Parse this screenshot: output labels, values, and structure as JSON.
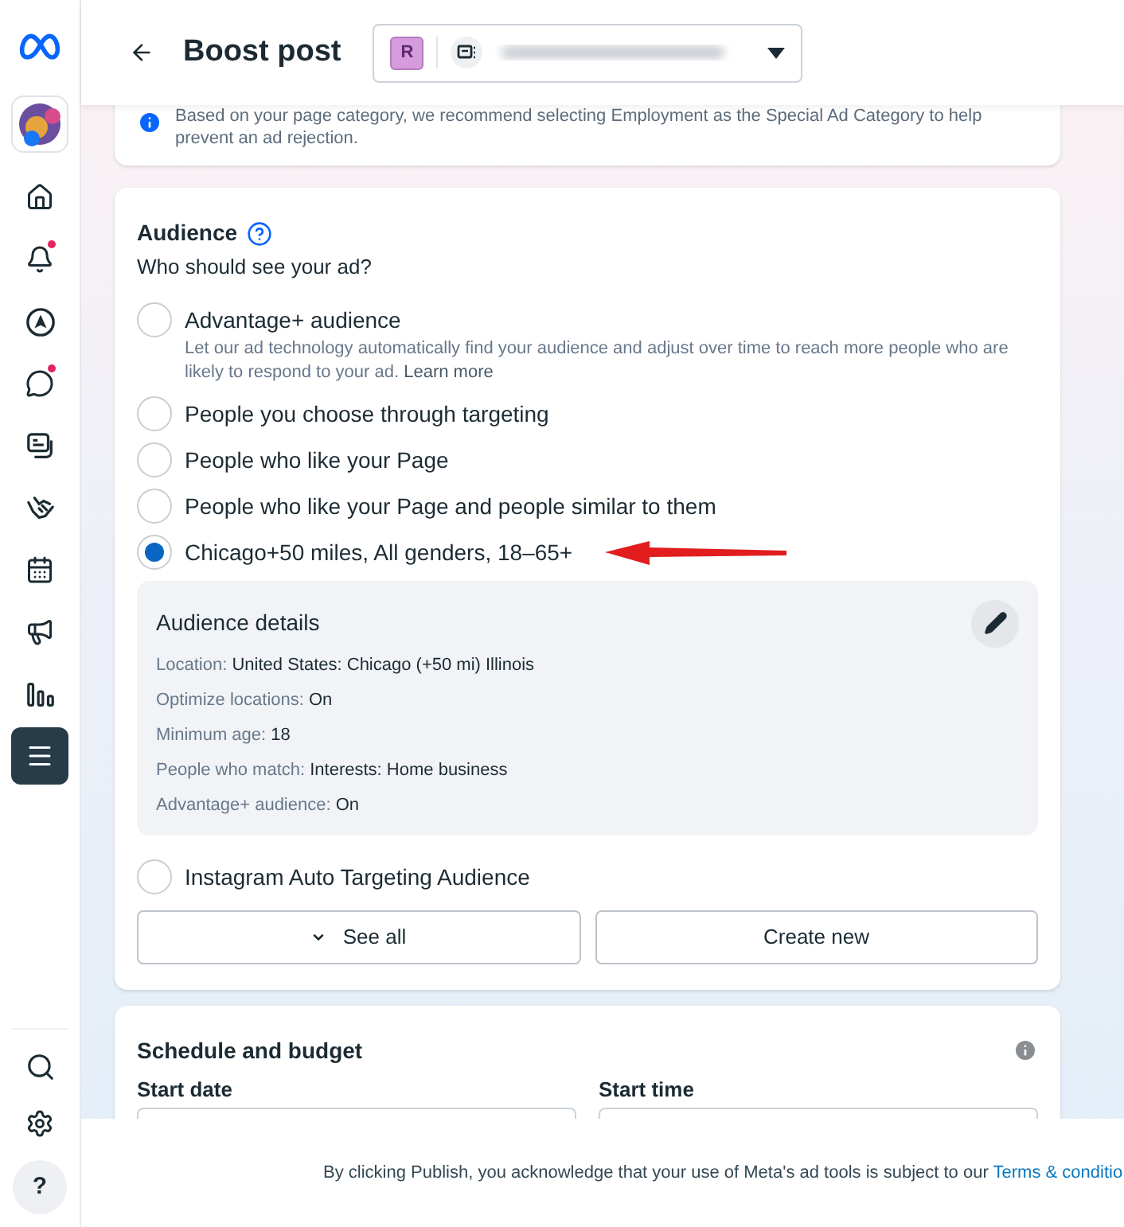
{
  "sidebar": {
    "items": [
      {
        "kind": "home",
        "selected": false,
        "badge": false
      },
      {
        "kind": "bell",
        "selected": false,
        "badge": true
      },
      {
        "kind": "compass",
        "selected": false,
        "badge": false
      },
      {
        "kind": "chat",
        "selected": false,
        "badge": true
      },
      {
        "kind": "cards",
        "selected": false,
        "badge": false
      },
      {
        "kind": "handshake",
        "selected": false,
        "badge": false
      },
      {
        "kind": "calendar",
        "selected": false,
        "badge": false
      },
      {
        "kind": "megaphone",
        "selected": false,
        "badge": false
      },
      {
        "kind": "chart",
        "selected": false,
        "badge": false
      },
      {
        "kind": "menu",
        "selected": true,
        "badge": false
      }
    ],
    "bottom": [
      {
        "kind": "search"
      },
      {
        "kind": "settings"
      },
      {
        "kind": "help",
        "label": "?"
      }
    ]
  },
  "header": {
    "title": "Boost post",
    "account": {
      "initial": "R"
    }
  },
  "notice": {
    "text": "Based on your page category, we recommend selecting Employment as the Special Ad Category to help prevent an ad rejection."
  },
  "audience": {
    "title": "Audience",
    "subtitle": "Who should see your ad?",
    "options": [
      {
        "label": "Advantage+ audience",
        "selected": false,
        "description": "Let our ad technology automatically find your audience and adjust over time to reach more people who are likely to respond to your ad.",
        "link": "Learn more"
      },
      {
        "label": "People you choose through targeting",
        "selected": false
      },
      {
        "label": "People who like your Page",
        "selected": false
      },
      {
        "label": "People who like your Page and people similar to them",
        "selected": false
      },
      {
        "label": "Chicago+50 miles, All genders, 18–65+",
        "selected": true,
        "details": {
          "title": "Audience details",
          "rows": [
            {
              "label": "Location:",
              "value": "United States: Chicago (+50 mi) Illinois"
            },
            {
              "label": "Optimize locations:",
              "value": "On"
            },
            {
              "label": "Minimum age:",
              "value": "18"
            },
            {
              "label": "People who match:",
              "value": "Interests: Home business"
            },
            {
              "label": "Advantage+ audience:",
              "value": "On"
            }
          ]
        }
      },
      {
        "label": "Instagram Auto Targeting Audience",
        "selected": false
      }
    ],
    "buttons": [
      {
        "label": "See all",
        "kind": "expand"
      },
      {
        "label": "Create new",
        "kind": "plain"
      }
    ]
  },
  "schedule": {
    "title": "Schedule and budget",
    "fields": [
      {
        "label": "Start date"
      },
      {
        "label": "Start time"
      }
    ]
  },
  "footer": {
    "text": "By clicking Publish, you acknowledge that your use of Meta's ad tools is subject to our",
    "link": "Terms & conditio"
  }
}
